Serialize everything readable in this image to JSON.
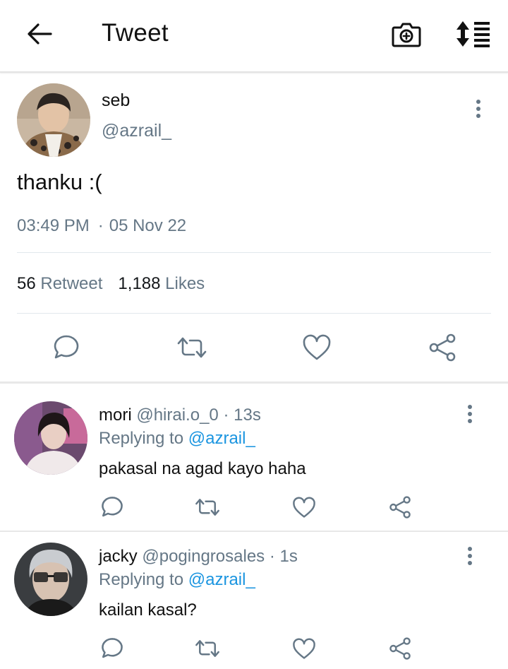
{
  "header": {
    "title": "Tweet",
    "back_icon": "arrow-left-icon",
    "camera_icon": "camera-plus-icon",
    "sort_icon": "sort-list-icon"
  },
  "tweet": {
    "name": "seb",
    "handle": "@azrail_",
    "text": "thanku :(",
    "time": "03:49 PM",
    "separator": "·",
    "date": "05 Nov 22",
    "retweet_count": "56",
    "retweet_label": "Retweet",
    "like_count": "1,188",
    "like_label": "Likes"
  },
  "replies": [
    {
      "name": "mori",
      "handle": "@hirai.o_0",
      "separator": "·",
      "time": "13s",
      "replying_prefix": "Replying to",
      "replying_to": "@azrail_",
      "text": "pakasal na agad kayo haha"
    },
    {
      "name": "jacky",
      "handle": "@pogingrosales",
      "separator": "·",
      "time": "1s",
      "replying_prefix": "Replying to",
      "replying_to": "@azrail_",
      "text": "kailan kasal?"
    }
  ],
  "colors": {
    "link": "#1b95e0",
    "muted": "#657786",
    "icon": "#657786"
  }
}
